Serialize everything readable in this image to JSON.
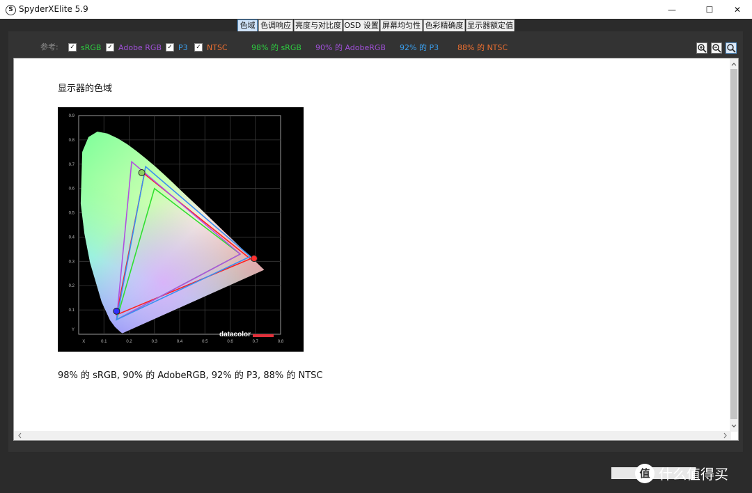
{
  "window": {
    "icon_letter": "S",
    "title": "SpyderXElite 5.9",
    "minimize_glyph": "—",
    "maximize_glyph": "☐",
    "close_glyph": "✕"
  },
  "tabs": [
    {
      "label": "色域",
      "active": true
    },
    {
      "label": "色调响应",
      "active": false
    },
    {
      "label": "亮度与对比度",
      "active": false
    },
    {
      "label": "OSD 设置",
      "active": false
    },
    {
      "label": "屏幕均匀性",
      "active": false
    },
    {
      "label": "色彩精确度",
      "active": false
    },
    {
      "label": "显示器额定值",
      "active": false
    }
  ],
  "reference": {
    "label": "参考:",
    "options": [
      {
        "label": "sRGB",
        "checked": true,
        "color": "#2ecc40"
      },
      {
        "label": "Adobe RGB",
        "checked": true,
        "color": "#a050d8"
      },
      {
        "label": "P3",
        "checked": true,
        "color": "#3aa0f0"
      },
      {
        "label": "NTSC",
        "checked": true,
        "color": "#f07030"
      }
    ],
    "results": [
      {
        "text": "98% 的 sRGB",
        "color": "#2ecc40"
      },
      {
        "text": "90% 的 AdobeRGB",
        "color": "#a050d8"
      },
      {
        "text": "92% 的 P3",
        "color": "#3aa0f0"
      },
      {
        "text": "88% 的 NTSC",
        "color": "#f07030"
      }
    ],
    "checkmark": "✓"
  },
  "zoom_icons": [
    "zoom-in-icon",
    "zoom-out-icon",
    "zoom-fit-icon"
  ],
  "report": {
    "title": "显示器的色域",
    "summary": "98% 的 sRGB, 90% 的 AdobeRGB, 92% 的 P3, 88% 的 NTSC"
  },
  "chart": {
    "type": "cie-chromaticity",
    "x_ticks": [
      "X",
      "0.1",
      "0.2",
      "0.3",
      "0.4",
      "0.5",
      "0.6",
      "0.7",
      "0.8"
    ],
    "y_ticks": [
      "0.9",
      "0.8",
      "0.7",
      "0.6",
      "0.5",
      "0.4",
      "0.3",
      "0.2",
      "0.1",
      "Y"
    ],
    "logo": "datacolor",
    "gamuts": [
      {
        "name": "display",
        "color": "#ff2020",
        "points": [
          [
            0.68,
            0.31
          ],
          [
            0.26,
            0.66
          ],
          [
            0.15,
            0.08
          ]
        ]
      },
      {
        "name": "sRGB",
        "color": "#30e030",
        "points": [
          [
            0.64,
            0.33
          ],
          [
            0.3,
            0.6
          ],
          [
            0.15,
            0.06
          ]
        ]
      },
      {
        "name": "Adobe RGB",
        "color": "#b050e0",
        "points": [
          [
            0.64,
            0.33
          ],
          [
            0.21,
            0.71
          ],
          [
            0.15,
            0.06
          ]
        ]
      },
      {
        "name": "P3",
        "color": "#3a90f0",
        "points": [
          [
            0.68,
            0.32
          ],
          [
            0.265,
            0.69
          ],
          [
            0.15,
            0.06
          ]
        ]
      }
    ],
    "primaries": [
      {
        "color": "#ff3030",
        "point": [
          0.695,
          0.312
        ]
      },
      {
        "color": "#8ad060",
        "point": [
          0.25,
          0.665
        ]
      },
      {
        "color": "#3030ff",
        "point": [
          0.15,
          0.095
        ]
      }
    ]
  },
  "watermark": {
    "icon": "值",
    "text": "什么值得买"
  }
}
